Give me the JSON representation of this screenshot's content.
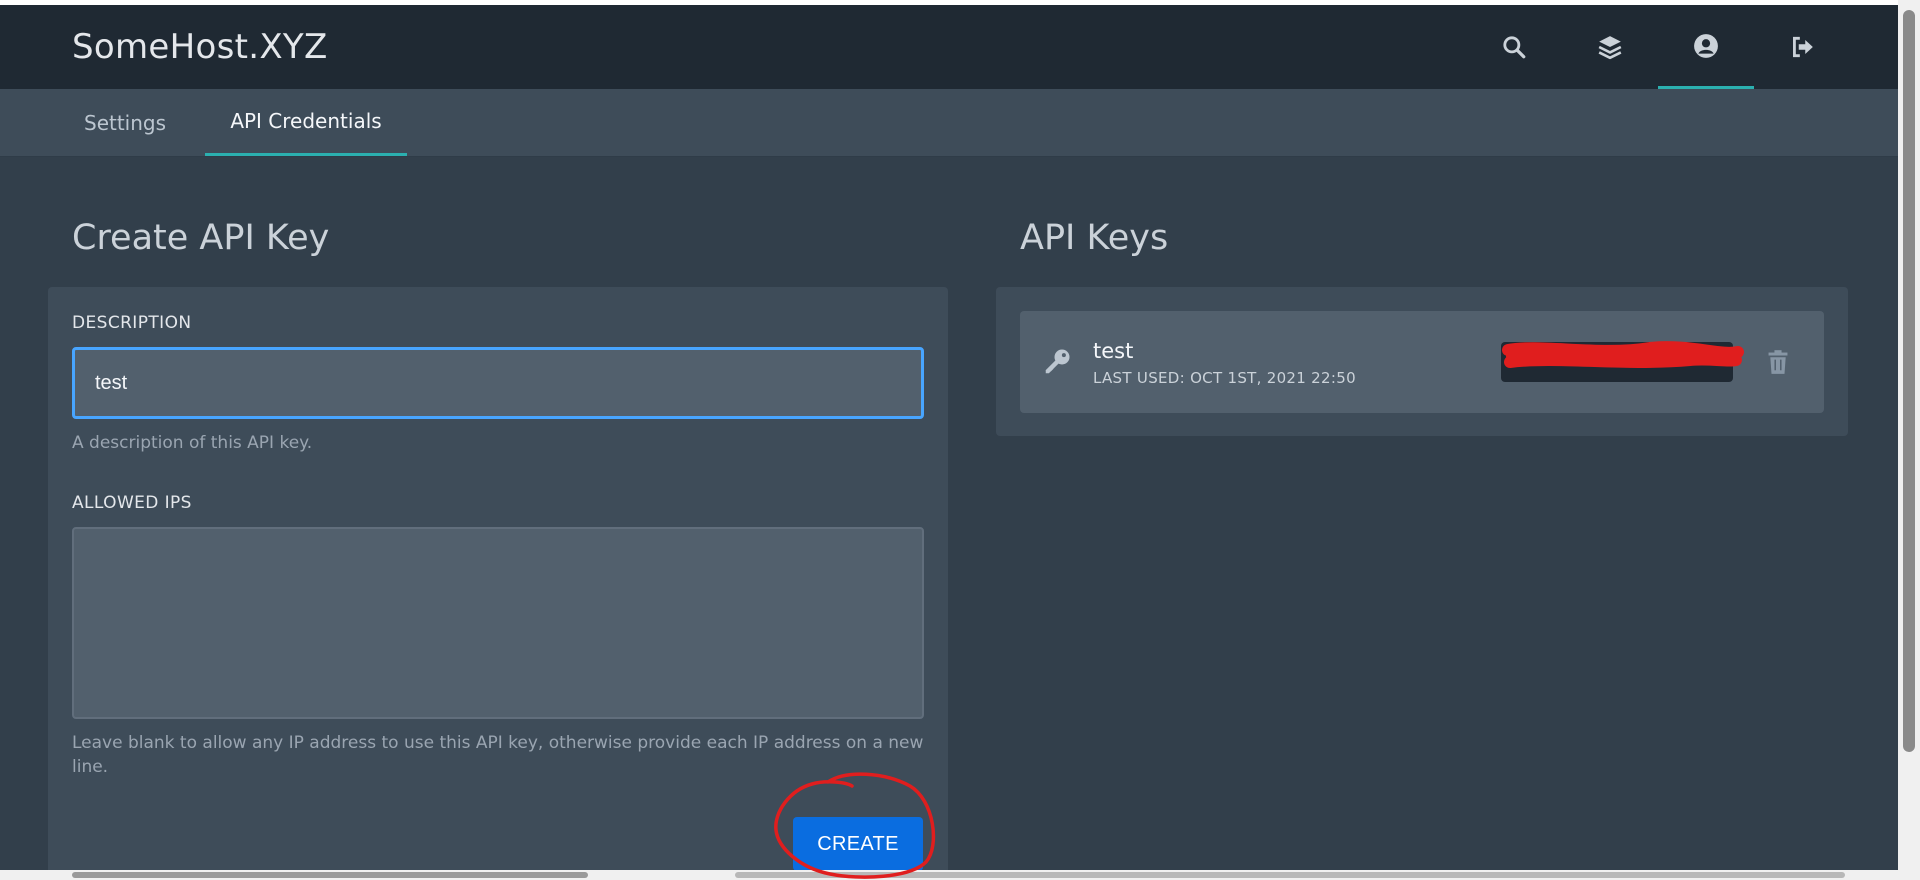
{
  "app": {
    "title": "SomeHost.XYZ"
  },
  "nav": {
    "icons": [
      {
        "name": "search-icon"
      },
      {
        "name": "layers-icon"
      },
      {
        "name": "account-icon",
        "active": true
      },
      {
        "name": "logout-icon"
      }
    ]
  },
  "tabs": [
    {
      "label": "Settings",
      "active": false
    },
    {
      "label": "API Credentials",
      "active": true
    }
  ],
  "create": {
    "title": "Create API Key",
    "description_label": "DESCRIPTION",
    "description_value": "test",
    "description_help": "A description of this API key.",
    "allowed_ips_label": "ALLOWED IPS",
    "allowed_ips_value": "",
    "allowed_ips_help": "Leave blank to allow any IP address to use this API key, otherwise provide each IP address on a new line.",
    "button_label": "CREATE"
  },
  "keys": {
    "title": "API Keys",
    "items": [
      {
        "name": "test",
        "last_used": "LAST USED: OCT 1ST, 2021 22:50"
      }
    ]
  },
  "colors": {
    "accent": "#2bb0b0",
    "primary_button": "#0a6de0",
    "focus_border": "#48a5ff",
    "annotation": "#e01e1e"
  }
}
